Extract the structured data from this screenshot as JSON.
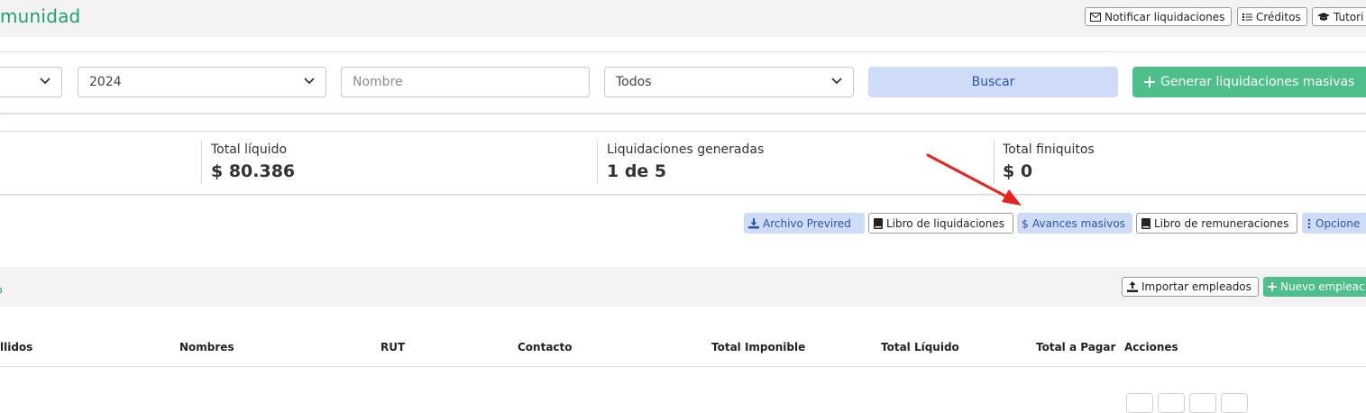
{
  "header": {
    "title": "munidad",
    "notify_label": "Notificar liquidaciones",
    "credits_label": "Créditos",
    "tutorial_label": "Tutori"
  },
  "filters": {
    "month_value": "",
    "year_value": "2024",
    "name_placeholder": "Nombre",
    "status_value": "Todos",
    "search_label": "Buscar",
    "generate_label": "Generar liquidaciones masivas"
  },
  "stats": [
    {
      "label": "Total líquido",
      "value": "$ 80.386"
    },
    {
      "label": "Liquidaciones generadas",
      "value": "1 de 5"
    },
    {
      "label": "Total finiquitos",
      "value": "$ 0"
    }
  ],
  "actions": {
    "previred_label": "Archivo Previred",
    "libro_liquidaciones_label": "Libro de liquidaciones",
    "avances_label": "Avances masivos",
    "libro_remuneraciones_label": "Libro de remuneraciones",
    "opciones_label": "Opcione"
  },
  "employees": {
    "import_label": "Importar empleados",
    "new_label": "Nuevo empleac",
    "columns": [
      "llidos",
      "Nombres",
      "RUT",
      "Contacto",
      "Total Imponible",
      "Total Líquido",
      "Total a Pagar",
      "Acciones"
    ]
  },
  "colors": {
    "accent_green": "#1f9d77",
    "button_green": "#4fbf8a",
    "button_blue_bg": "#cfdcf8",
    "button_blue_text": "#2b55b0",
    "annotation_arrow": "#e8231f"
  }
}
